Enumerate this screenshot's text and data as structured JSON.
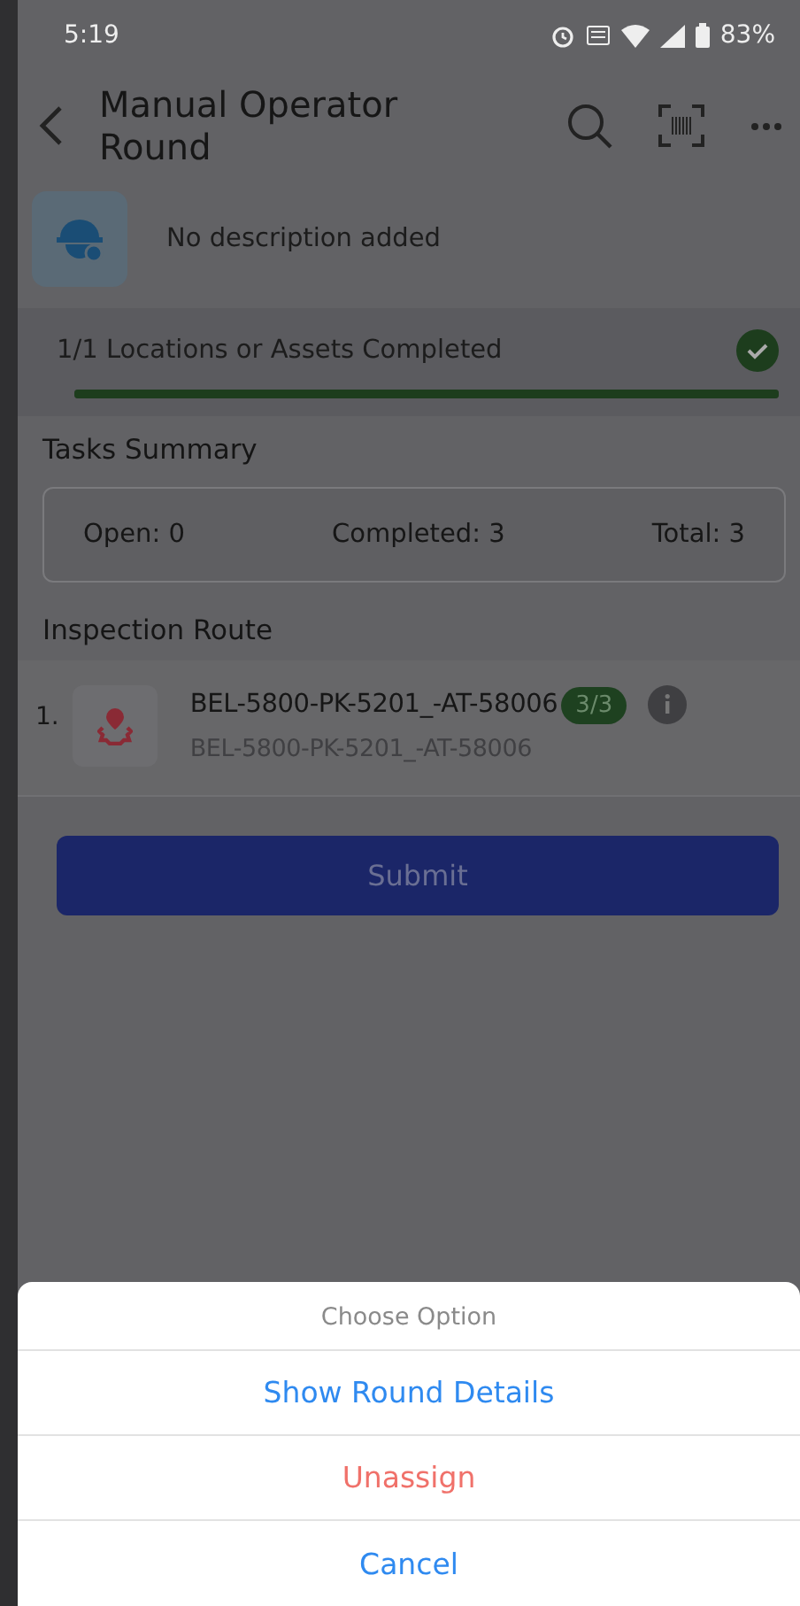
{
  "status_bar": {
    "time": "5:19",
    "battery": "83%"
  },
  "header": {
    "title": "Manual Operator Round"
  },
  "description": "No description added",
  "progress": {
    "label": "1/1 Locations or Assets Completed",
    "level": 1,
    "completed": true
  },
  "tasks_summary": {
    "title": "Tasks Summary",
    "items": [
      "Open: 0",
      "Completed: 3",
      "Total: 3"
    ]
  },
  "inspection_route": {
    "title": "Inspection Route",
    "items": [
      {
        "number": "1.",
        "name": "BEL-5800-PK-5201_-AT-58006",
        "subtitle": "BEL-5800-PK-5201_-AT-58006",
        "badge": "3/3"
      }
    ]
  },
  "submit_button": "Submit",
  "action_sheet": {
    "title": "Choose Option",
    "actions": [
      {
        "label": "Show Round Details",
        "kind": "default"
      },
      {
        "label": "Unassign",
        "kind": "destructive"
      },
      {
        "label": "Cancel",
        "kind": "default"
      }
    ]
  }
}
